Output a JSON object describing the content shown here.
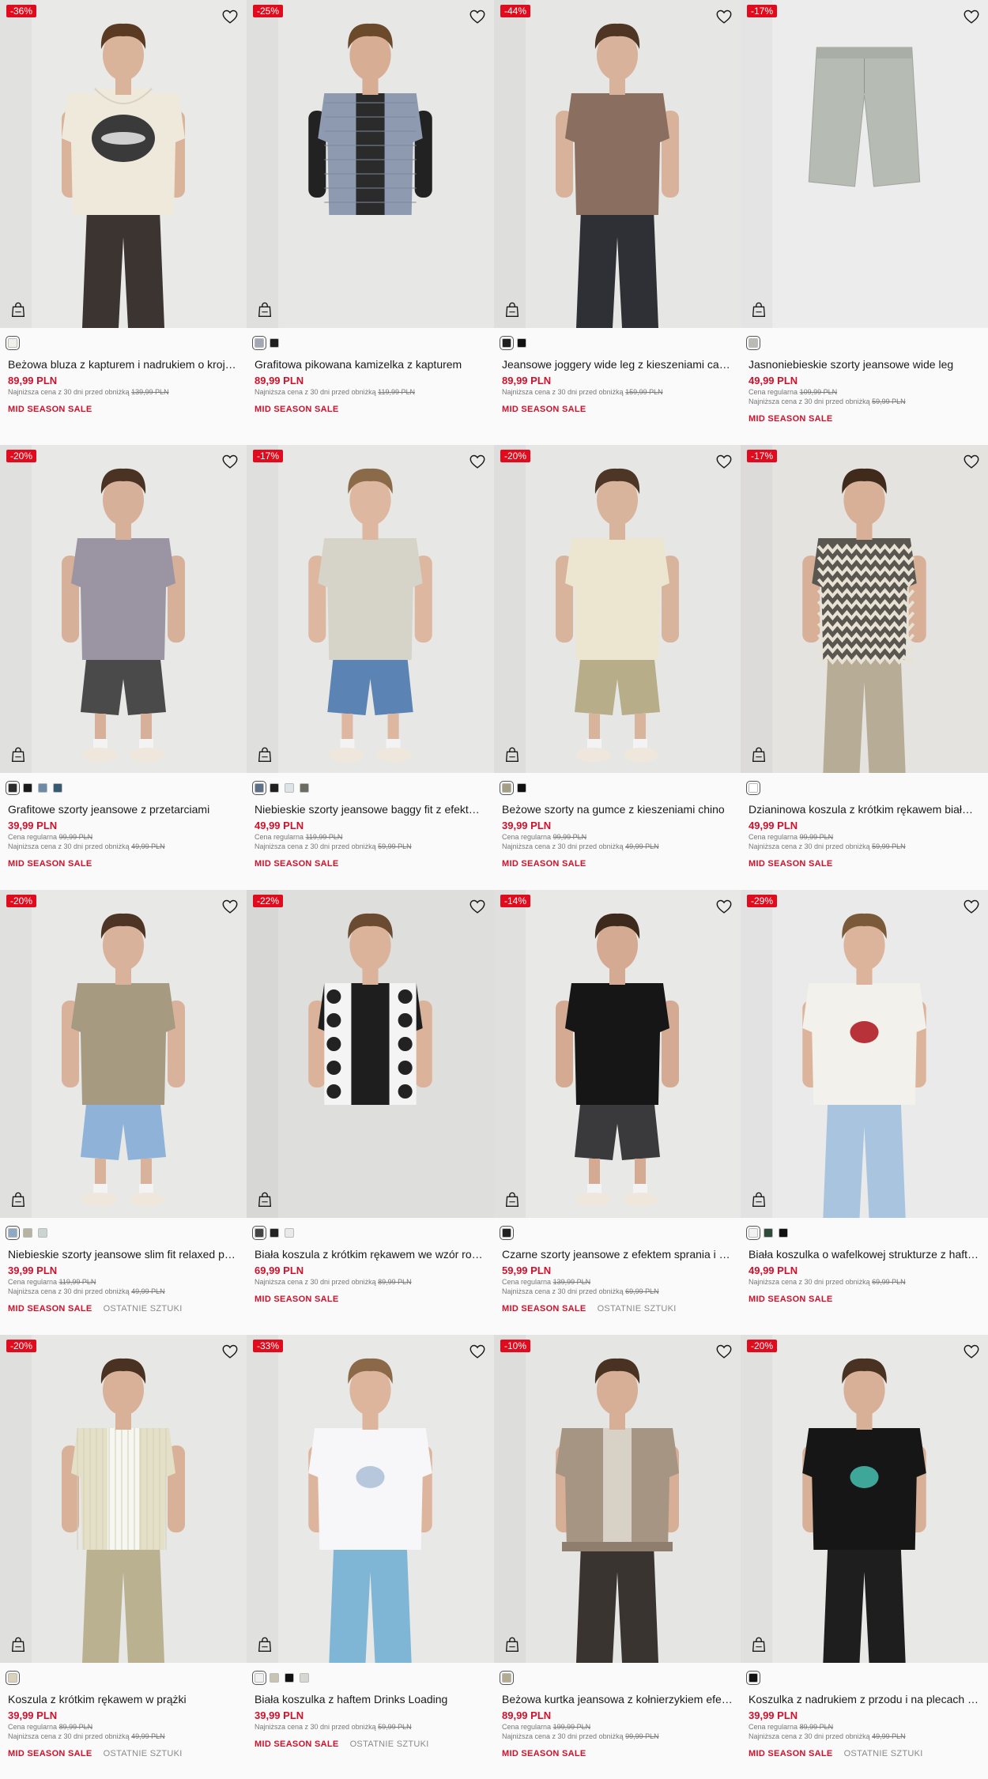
{
  "products": [
    {
      "discount": "-36%",
      "name": "Beżowa bluza z kapturem i nadrukiem o kroj…",
      "price": "89,99 PLN",
      "regular_label": "",
      "regular_price": "",
      "lowest_label": "Najniższa cena z 30 dni przed obniżką",
      "lowest_price": "139,99 PLN",
      "tags": [
        "MID SEASON SALE"
      ],
      "swatches": [
        "#f2f0ea"
      ],
      "bg": "#e9e9e7",
      "skin": "#d9b39a",
      "hair": "#5a3a22",
      "top": "#efe9dc",
      "top_style": "hoodie",
      "print": "#3a3a3a",
      "bottom": "#3b3431",
      "bottom_style": "pants"
    },
    {
      "discount": "-25%",
      "name": "Grafitowa pikowana kamizelka z kapturem",
      "price": "89,99 PLN",
      "regular_label": "",
      "regular_price": "",
      "lowest_label": "Najniższa cena z 30 dni przed obniżką",
      "lowest_price": "119,99 PLN",
      "tags": [
        "MID SEASON SALE"
      ],
      "swatches": [
        "#a2a7b3",
        "#1e1e1e"
      ],
      "bg": "#e7e7e5",
      "skin": "#d7ad94",
      "hair": "#6b4a2b",
      "top": "#8e9ab0",
      "top_style": "vest",
      "print": "#2b2b2b",
      "bottom": "#1f1f22",
      "bottom_style": "none"
    },
    {
      "discount": "-44%",
      "name": "Jeansowe joggery wide leg z kieszeniami ca…",
      "price": "89,99 PLN",
      "regular_label": "",
      "regular_price": "",
      "lowest_label": "Najniższa cena z 30 dni przed obniżką",
      "lowest_price": "159,99 PLN",
      "tags": [
        "MID SEASON SALE"
      ],
      "swatches": [
        "#1e1e1e",
        "#111111"
      ],
      "bg": "#e6e6e4",
      "skin": "#d8b29a",
      "hair": "#4e3524",
      "top": "#8a6e60",
      "top_style": "tee",
      "print": "",
      "bottom": "#2f3036",
      "bottom_style": "pants"
    },
    {
      "discount": "-17%",
      "name": "Jasnoniebieskie szorty jeansowe wide leg",
      "price": "49,99 PLN",
      "regular_label": "Cena regularna",
      "regular_price": "109,99 PLN",
      "lowest_label": "Najniższa cena z 30 dni przed obniżką",
      "lowest_price": "59,99 PLN",
      "tags": [
        "MID SEASON SALE"
      ],
      "swatches": [
        "#b9bcb4"
      ],
      "bg": "#ececec",
      "skin": "",
      "hair": "",
      "top": "",
      "top_style": "flat-shorts",
      "print": "",
      "bottom": "#b6bcb3",
      "bottom_style": "flat"
    },
    {
      "discount": "-20%",
      "name": "Grafitowe szorty jeansowe z przetarciami",
      "price": "39,99 PLN",
      "regular_label": "Cena regularna",
      "regular_price": "99,99 PLN",
      "lowest_label": "Najniższa cena z 30 dni przed obniżką",
      "lowest_price": "49,99 PLN",
      "tags": [
        "MID SEASON SALE"
      ],
      "swatches": [
        "#2b2b2b",
        "#1a1a1a",
        "#6d8aa6",
        "#365a70"
      ],
      "bg": "#e8e8e6",
      "skin": "#d7b09a",
      "hair": "#4a3322",
      "top": "#9b94a2",
      "top_style": "tee",
      "print": "",
      "bottom": "#4a4a4a",
      "bottom_style": "shorts"
    },
    {
      "discount": "-17%",
      "name": "Niebieskie szorty jeansowe baggy fit z efekt…",
      "price": "49,99 PLN",
      "regular_label": "Cena regularna",
      "regular_price": "119,99 PLN",
      "lowest_label": "Najniższa cena z 30 dni przed obniżką",
      "lowest_price": "59,99 PLN",
      "tags": [
        "MID SEASON SALE"
      ],
      "swatches": [
        "#5b6f86",
        "#1f1f1f",
        "#dce4e8",
        "#6b6b5f"
      ],
      "bg": "#e7e7e5",
      "skin": "#ddb7a0",
      "hair": "#8a6a48",
      "top": "#d6d3c9",
      "top_style": "tee",
      "print": "",
      "bottom": "#5b84b4",
      "bottom_style": "shorts"
    },
    {
      "discount": "-20%",
      "name": "Beżowe szorty na gumce z kieszeniami chino",
      "price": "39,99 PLN",
      "regular_label": "Cena regularna",
      "regular_price": "99,99 PLN",
      "lowest_label": "Najniższa cena z 30 dni przed obniżką",
      "lowest_price": "49,99 PLN",
      "tags": [
        "MID SEASON SALE"
      ],
      "swatches": [
        "#a59e86",
        "#111111"
      ],
      "bg": "#e6e6e4",
      "skin": "#d9b49c",
      "hair": "#4e3626",
      "top": "#ece5cf",
      "top_style": "tee",
      "print": "",
      "bottom": "#b7ad89",
      "bottom_style": "shorts"
    },
    {
      "discount": "-17%",
      "name": "Dzianinowa koszula z krótkim rękawem biał…",
      "price": "49,99 PLN",
      "regular_label": "Cena regularna",
      "regular_price": "99,99 PLN",
      "lowest_label": "Najniższa cena z 30 dni przed obniżką",
      "lowest_price": "59,99 PLN",
      "tags": [
        "MID SEASON SALE"
      ],
      "swatches": [
        "#ffffff"
      ],
      "bg": "#e4e3e0",
      "skin": "#d8b098",
      "hair": "#3f2a1c",
      "top": "#5a5650",
      "top_style": "zigzag",
      "print": "#e8e2d4",
      "bottom": "#b7ac95",
      "bottom_style": "pants"
    },
    {
      "discount": "-20%",
      "name": "Niebieskie szorty jeansowe slim fit relaxed p…",
      "price": "39,99 PLN",
      "regular_label": "Cena regularna",
      "regular_price": "119,99 PLN",
      "lowest_label": "Najniższa cena z 30 dni przed obniżką",
      "lowest_price": "49,99 PLN",
      "tags": [
        "MID SEASON SALE",
        "OSTATNIE SZTUKI"
      ],
      "swatches": [
        "#8ea9c4",
        "#b7b3a3",
        "#ccd4d2"
      ],
      "bg": "#e8e8e6",
      "skin": "#d8b29a",
      "hair": "#4d3424",
      "top": "#a69a80",
      "top_style": "tee",
      "print": "",
      "bottom": "#8fb3d8",
      "bottom_style": "shorts"
    },
    {
      "discount": "-22%",
      "name": "Biała koszula z krótkim rękawem we wzór ro…",
      "price": "69,99 PLN",
      "regular_label": "",
      "regular_price": "",
      "lowest_label": "Najniższa cena z 30 dni przed obniżką",
      "lowest_price": "89,99 PLN",
      "tags": [
        "MID SEASON SALE"
      ],
      "swatches": [
        "#444444",
        "#222222",
        "#e9e9e9"
      ],
      "bg": "#dededc",
      "skin": "#dbb29a",
      "hair": "#6a4a30",
      "top": "#1e1e1e",
      "top_style": "floral",
      "print": "#f4f4f4",
      "bottom": "#1e1e1e",
      "bottom_style": "none"
    },
    {
      "discount": "-14%",
      "name": "Czarne szorty jeansowe z efektem sprania i …",
      "price": "59,99 PLN",
      "regular_label": "Cena regularna",
      "regular_price": "139,99 PLN",
      "lowest_label": "Najniższa cena z 30 dni przed obniżką",
      "lowest_price": "69,99 PLN",
      "tags": [
        "MID SEASON SALE",
        "OSTATNIE SZTUKI"
      ],
      "swatches": [
        "#222222"
      ],
      "bg": "#e8e8e6",
      "skin": "#d4ab92",
      "hair": "#3e2a1c",
      "top": "#161616",
      "top_style": "tee",
      "print": "",
      "bottom": "#3a3a3c",
      "bottom_style": "shorts"
    },
    {
      "discount": "-29%",
      "name": "Biała koszulka o wafelkowej strukturze z haft…",
      "price": "49,99 PLN",
      "regular_label": "",
      "regular_price": "",
      "lowest_label": "Najniższa cena z 30 dni przed obniżką",
      "lowest_price": "69,99 PLN",
      "tags": [
        "MID SEASON SALE"
      ],
      "swatches": [
        "#f2f2f2",
        "#2e4a3a",
        "#111111"
      ],
      "bg": "#eaeaea",
      "skin": "#dcb49b",
      "hair": "#7b5a3a",
      "top": "#f3f1ec",
      "top_style": "tee-big",
      "print": "#b8323a",
      "bottom": "#a9c4de",
      "bottom_style": "pants"
    },
    {
      "discount": "-20%",
      "name": "Koszula z krótkim rękawem w prążki",
      "price": "39,99 PLN",
      "regular_label": "Cena regularna",
      "regular_price": "89,99 PLN",
      "lowest_label": "Najniższa cena z 30 dni przed obniżką",
      "lowest_price": "49,99 PLN",
      "tags": [
        "MID SEASON SALE",
        "OSTATNIE SZTUKI"
      ],
      "swatches": [
        "#d8d2bd"
      ],
      "bg": "#e7e7e5",
      "skin": "#d8b198",
      "hair": "#4a3222",
      "top": "#e4dfc7",
      "top_style": "shirt-open",
      "print": "#f7f7f2",
      "bottom": "#b9b18f",
      "bottom_style": "pants"
    },
    {
      "discount": "-33%",
      "name": "Biała koszulka z haftem Drinks Loading",
      "price": "39,99 PLN",
      "regular_label": "",
      "regular_price": "",
      "lowest_label": "Najniższa cena z 30 dni przed obniżką",
      "lowest_price": "59,99 PLN",
      "tags": [
        "MID SEASON SALE",
        "OSTATNIE SZTUKI"
      ],
      "swatches": [
        "#f0f0f0",
        "#c9c3b3",
        "#111111",
        "#d6d6d2"
      ],
      "bg": "#e8e8e6",
      "skin": "#ddb59d",
      "hair": "#8a6848",
      "top": "#f7f7f9",
      "top_style": "tee-big",
      "print": "#b8c8dc",
      "bottom": "#7fb6d6",
      "bottom_style": "pants"
    },
    {
      "discount": "-10%",
      "name": "Beżowa kurtka jeansowa z kołnierzykiem efe…",
      "price": "89,99 PLN",
      "regular_label": "Cena regularna",
      "regular_price": "199,99 PLN",
      "lowest_label": "Najniższa cena z 30 dni przed obniżką",
      "lowest_price": "99,99 PLN",
      "tags": [
        "MID SEASON SALE"
      ],
      "swatches": [
        "#b3ab91"
      ],
      "bg": "#e5e5e3",
      "skin": "#d7af97",
      "hair": "#4a3222",
      "top": "#a79584",
      "top_style": "jacket",
      "print": "#d8d2c6",
      "bottom": "#3a3431",
      "bottom_style": "pants"
    },
    {
      "discount": "-20%",
      "name": "Koszulka z nadrukiem z przodu i na plecach …",
      "price": "39,99 PLN",
      "regular_label": "Cena regularna",
      "regular_price": "89,99 PLN",
      "lowest_label": "Najniższa cena z 30 dni przed obniżką",
      "lowest_price": "49,99 PLN",
      "tags": [
        "MID SEASON SALE",
        "OSTATNIE SZTUKI"
      ],
      "swatches": [
        "#111111"
      ],
      "bg": "#e8e8e6",
      "skin": "#d8b098",
      "hair": "#4a3222",
      "top": "#161616",
      "top_style": "tee-big",
      "print": "#3fa79a",
      "bottom": "#1e1e1e",
      "bottom_style": "pants"
    }
  ],
  "icons": {
    "heart": "heart-icon",
    "bag": "shopping-bag-icon"
  },
  "colors": {
    "sale_red": "#e00c1d",
    "price_red": "#d0112b",
    "tag_grey": "#8a8a8a"
  }
}
